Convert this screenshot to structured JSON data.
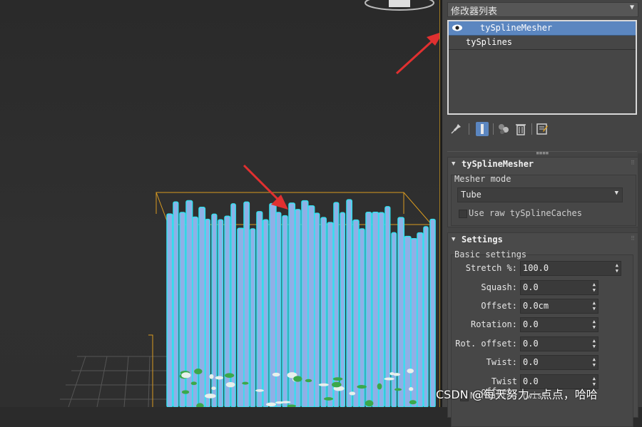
{
  "modifier_dropdown": {
    "label": "修改器列表"
  },
  "stack": {
    "items": [
      {
        "label": "tySplineMesher",
        "selected": true
      },
      {
        "label": "tySplines",
        "selected": false
      }
    ]
  },
  "toolbar": {
    "icons": [
      "pin-stack-icon",
      "show-end-result-icon",
      "make-unique-icon",
      "remove-modifier-icon",
      "configure-modifier-sets-icon"
    ]
  },
  "rollout_mesher": {
    "title": "tySplineMesher",
    "mesher_mode_label": "Mesher mode",
    "mesher_mode_value": "Tube",
    "use_raw_label": "Use raw tySplineCaches"
  },
  "rollout_settings": {
    "title": "Settings",
    "basic_label": "Basic settings",
    "params": [
      {
        "label": "Stretch %:",
        "value": "100.0"
      },
      {
        "label": "Squash:",
        "value": "0.0"
      },
      {
        "label": "Offset:",
        "value": "0.0cm"
      },
      {
        "label": "Rotation:",
        "value": "0.0"
      },
      {
        "label": "Rot. offset:",
        "value": "0.0"
      },
      {
        "label": "Twist:",
        "value": "0.0"
      },
      {
        "label": "Twist offset:",
        "value": "0.0"
      }
    ],
    "normalize_label": "Normalize twist"
  },
  "watermark": "CSDN @每天努力一点点，哈哈",
  "colors": {
    "accent_selection": "#5b86c0",
    "annotation_arrow": "#e03030",
    "bbox": "#d89a20",
    "tube_fill": "#8fb0e6",
    "tube_outline": "#35e0ef"
  }
}
